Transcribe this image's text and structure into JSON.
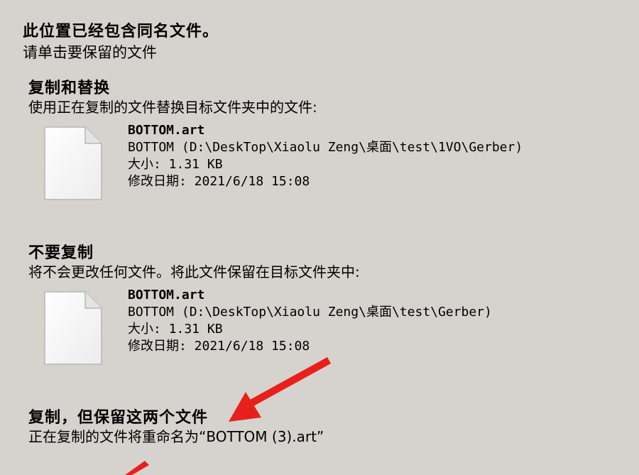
{
  "header": {
    "title": "此位置已经包含同名文件。",
    "subtitle": "请单击要保留的文件"
  },
  "options": [
    {
      "title": "复制和替换",
      "description": "使用正在复制的文件替换目标文件夹中的文件:",
      "file": {
        "name": "BOTTOM.art",
        "location": "BOTTOM (D:\\DeskTop\\Xiaolu Zeng\\桌面\\test\\1VO\\Gerber)",
        "size": "大小: 1.31 KB",
        "modified": "修改日期: 2021/6/18 15:08"
      }
    },
    {
      "title": "不要复制",
      "description": "将不会更改任何文件。将此文件保留在目标文件夹中:",
      "file": {
        "name": "BOTTOM.art",
        "location": "BOTTOM (D:\\DeskTop\\Xiaolu Zeng\\桌面\\test\\Gerber)",
        "size": "大小: 1.31 KB",
        "modified": "修改日期: 2021/6/18 15:08"
      }
    },
    {
      "title": "复制，但保留这两个文件",
      "description": "正在复制的文件将重命名为“BOTTOM (3).art”"
    }
  ],
  "icons": {
    "file": "blank-document-icon",
    "annotation": "red-arrow-icon"
  },
  "colors": {
    "background": "#d6d3ce",
    "arrow": "#e8201c"
  }
}
